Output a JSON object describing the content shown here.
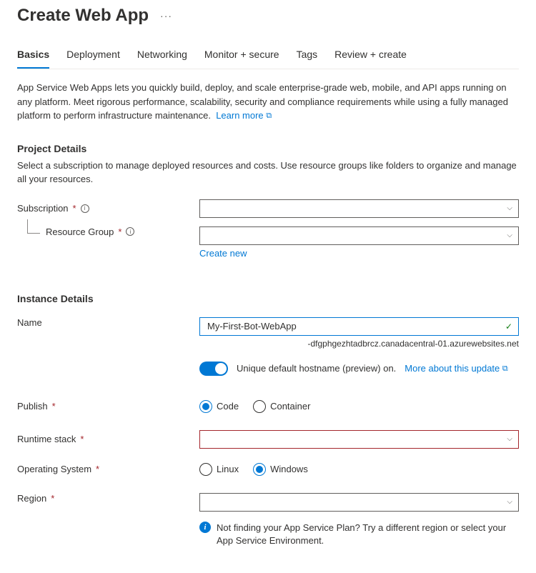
{
  "title": "Create Web App",
  "tabs": [
    "Basics",
    "Deployment",
    "Networking",
    "Monitor + secure",
    "Tags",
    "Review + create"
  ],
  "intro": {
    "text": "App Service Web Apps lets you quickly build, deploy, and scale enterprise-grade web, mobile, and API apps running on any platform. Meet rigorous performance, scalability, security and compliance requirements while using a fully managed platform to perform infrastructure maintenance.",
    "learn_more": "Learn more"
  },
  "project": {
    "heading": "Project Details",
    "desc": "Select a subscription to manage deployed resources and costs. Use resource groups like folders to organize and manage all your resources.",
    "subscription_label": "Subscription",
    "resource_group_label": "Resource Group",
    "create_new": "Create new"
  },
  "instance": {
    "heading": "Instance Details",
    "name_label": "Name",
    "name_value": "My-First-Bot-WebApp",
    "suffix": "-dfgphgezhtadbrcz.canadacentral-01.azurewebsites.net",
    "toggle_label": "Unique default hostname (preview) on.",
    "toggle_link": "More about this update",
    "publish_label": "Publish",
    "publish_options": {
      "code": "Code",
      "container": "Container"
    },
    "runtime_label": "Runtime stack",
    "os_label": "Operating System",
    "os_options": {
      "linux": "Linux",
      "windows": "Windows"
    },
    "region_label": "Region",
    "region_note": "Not finding your App Service Plan? Try a different region or select your App Service Environment."
  }
}
